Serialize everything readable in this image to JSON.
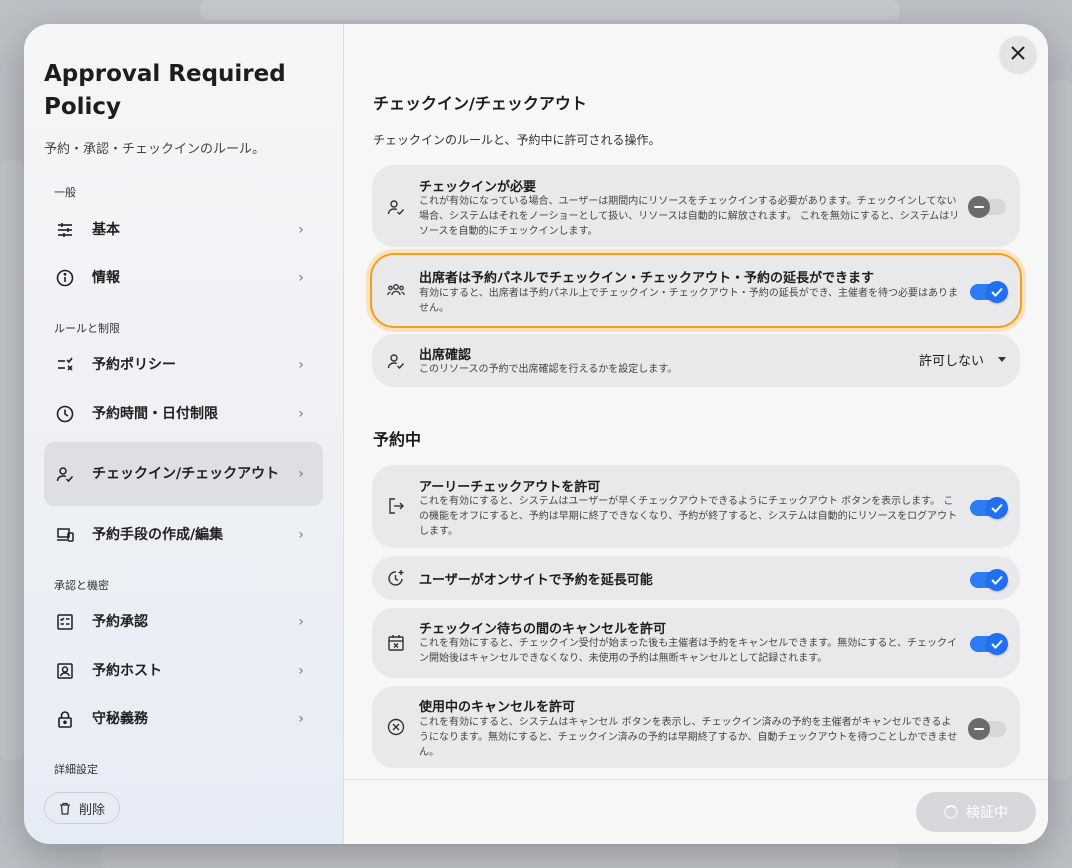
{
  "sidebar": {
    "title": "Approval Required Policy",
    "subtitle": "予約・承認・チェックインのルール。",
    "sections": {
      "general": "一般",
      "rules": "ルールと制限",
      "approval": "承認と機密",
      "advanced": "詳細設定"
    },
    "items": [
      {
        "label": "基本",
        "icon": "sliders-icon"
      },
      {
        "label": "情報",
        "icon": "info-icon"
      },
      {
        "label": "予約ポリシー",
        "icon": "checklist-icon"
      },
      {
        "label": "予約時間・日付制限",
        "icon": "clock-icon"
      },
      {
        "label": "チェックイン/チェックアウト",
        "icon": "person-check-icon",
        "active": true
      },
      {
        "label": "予約手段の作成/編集",
        "icon": "devices-icon"
      },
      {
        "label": "予約承認",
        "icon": "approval-icon"
      },
      {
        "label": "予約ホスト",
        "icon": "host-icon"
      },
      {
        "label": "守秘義務",
        "icon": "lock-icon"
      }
    ],
    "delete_label": "削除"
  },
  "main": {
    "section1_title": "チェックイン/チェックアウト",
    "section1_desc": "チェックインのルールと、予約中に許可される操作。",
    "section2_title": "予約中",
    "cards": [
      {
        "title": "チェックインが必要",
        "desc": "これが有効になっている場合、ユーザーは期間内にリソースをチェックインする必要があります。チェックインしてない場合、システムはそれをノーショーとして扱い、リソースは自動的に解放されます。 これを無効にすると、システムはリソースを自動的にチェックインします。",
        "enabled": false
      },
      {
        "title": "出席者は予約パネルでチェックイン・チェックアウト・予約の延長ができます",
        "desc": "有効にすると、出席者は予約パネル上でチェックイン・チェックアウト・予約の延長ができ、主催者を待つ必要はありません。",
        "enabled": true
      },
      {
        "title": "出席確認",
        "desc": "このリソースの予約で出席確認を行えるかを設定します。",
        "select_value": "許可しない"
      },
      {
        "title": "アーリーチェックアウトを許可",
        "desc": "これを有効にすると、システムはユーザーが早くチェックアウトできるようにチェックアウト ボタンを表示します。 この機能をオフにすると、予約は早期に終了できなくなり、予約が終了すると、システムは自動的にリソースをログアウトします。",
        "enabled": true
      },
      {
        "title": "ユーザーがオンサイトで予約を延長可能",
        "enabled": true
      },
      {
        "title": "チェックイン待ちの間のキャンセルを許可",
        "desc": "これを有効にすると、チェックイン受付が始まった後も主催者は予約をキャンセルできます。無効にすると、チェックイン開始後はキャンセルできなくなり、未使用の予約は無断キャンセルとして記録されます。",
        "enabled": true
      },
      {
        "title": "使用中のキャンセルを許可",
        "desc": "これを有効にすると、システムはキャンセル ボタンを表示し、チェックイン済みの予約を主催者がキャンセルできるようになります。無効にすると、チェックイン済みの予約は早期終了するか、自動チェックアウトを待つことしかできません。",
        "enabled": false
      }
    ]
  },
  "footer": {
    "verify_label": "検証中"
  },
  "colors": {
    "accent": "#1f6ff0",
    "highlight": "#f2a01c"
  }
}
